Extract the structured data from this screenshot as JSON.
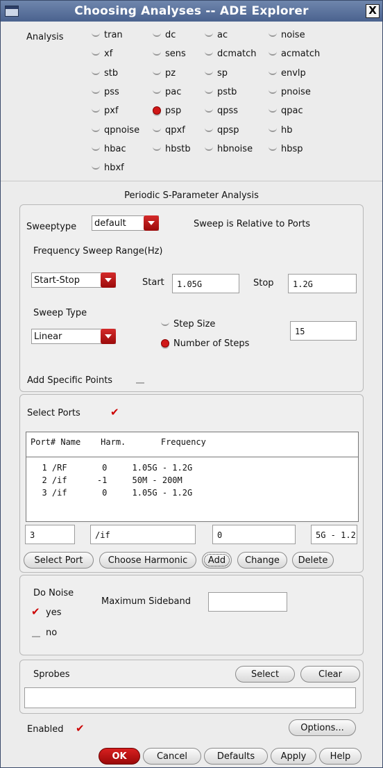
{
  "window": {
    "title": "Choosing Analyses -- ADE Explorer",
    "close_glyph": "X"
  },
  "analysis": {
    "label": "Analysis",
    "options": [
      [
        "tran",
        "dc",
        "ac",
        "noise"
      ],
      [
        "xf",
        "sens",
        "dcmatch",
        "acmatch"
      ],
      [
        "stb",
        "pz",
        "sp",
        "envlp"
      ],
      [
        "pss",
        "pac",
        "pstb",
        "pnoise"
      ],
      [
        "pxf",
        "psp",
        "qpss",
        "qpac"
      ],
      [
        "qpnoise",
        "qpxf",
        "qpsp",
        "hb"
      ],
      [
        "hbac",
        "hbstb",
        "hbnoise",
        "hbsp"
      ],
      [
        "hbxf"
      ]
    ],
    "selected": "psp"
  },
  "section_title": "Periodic S-Parameter Analysis",
  "sweep": {
    "sweeptype_label": "Sweeptype",
    "sweeptype_value": "default",
    "relative_note": "Sweep is Relative to Ports",
    "range_label": "Frequency Sweep Range(Hz)",
    "range_mode": "Start-Stop",
    "start_label": "Start",
    "start_value": "1.05G",
    "stop_label": "Stop",
    "stop_value": "1.2G",
    "type_label": "Sweep Type",
    "type_value": "Linear",
    "step_size_label": "Step Size",
    "num_steps_label": "Number of Steps",
    "num_steps_value": "15",
    "add_points_label": "Add Specific Points"
  },
  "ports": {
    "select_label": "Select Ports",
    "header": "Port# Name    Harm.       Frequency",
    "rows": [
      "  1 /RF       0     1.05G - 1.2G",
      "  2 /if      -1     50M - 200M",
      "  3 /if       0     1.05G - 1.2G"
    ],
    "edit_port": "3",
    "edit_name": "/if",
    "edit_harm": "0",
    "edit_freq": "5G - 1.2",
    "buttons": {
      "select_port": "Select Port",
      "choose_harmonic": "Choose Harmonic",
      "add": "Add",
      "change": "Change",
      "delete": "Delete"
    }
  },
  "noise": {
    "label": "Do Noise",
    "yes": "yes",
    "no": "no",
    "max_sideband_label": "Maximum Sideband",
    "max_sideband_value": ""
  },
  "sprobes": {
    "label": "Sprobes",
    "select": "Select",
    "clear": "Clear",
    "value": ""
  },
  "footer": {
    "enabled_label": "Enabled",
    "options": "Options...",
    "ok": "OK",
    "cancel": "Cancel",
    "defaults": "Defaults",
    "apply": "Apply",
    "help": "Help"
  }
}
